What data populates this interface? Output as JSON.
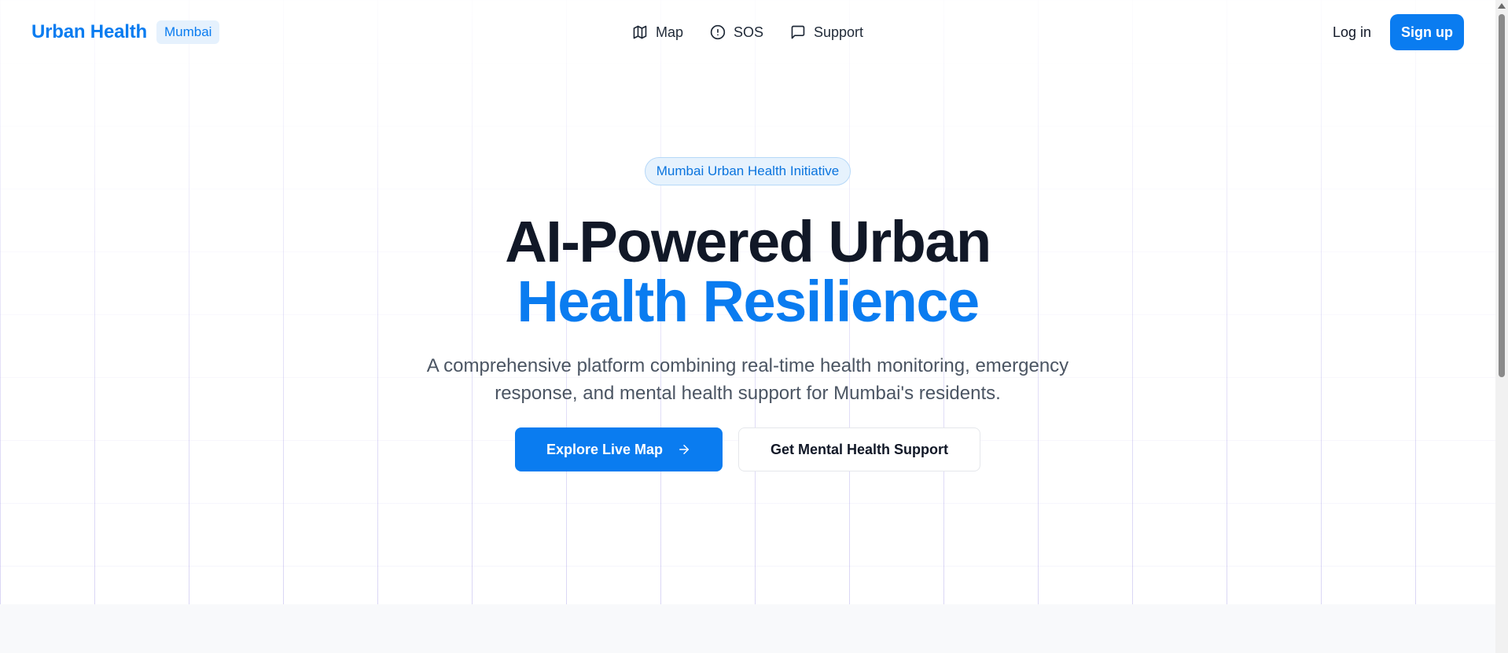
{
  "brand": {
    "name": "Urban Health",
    "badge": "Mumbai"
  },
  "nav": {
    "items": [
      {
        "label": "Map",
        "icon": "map-icon"
      },
      {
        "label": "SOS",
        "icon": "alert-circle-icon"
      },
      {
        "label": "Support",
        "icon": "message-square-icon"
      }
    ]
  },
  "auth": {
    "login_label": "Log in",
    "signup_label": "Sign up"
  },
  "hero": {
    "pill": "Mumbai Urban Health Initiative",
    "title_line1": "AI-Powered Urban",
    "title_line2": "Health Resilience",
    "subtitle": "A comprehensive platform combining real-time health monitoring, emergency response, and mental health support for Mumbai's residents.",
    "primary_cta": "Explore Live Map",
    "secondary_cta": "Get Mental Health Support"
  },
  "colors": {
    "accent": "#0a7cf0",
    "heading": "#111827",
    "body": "#4b5563",
    "pill_bg": "#e6f2fd"
  }
}
